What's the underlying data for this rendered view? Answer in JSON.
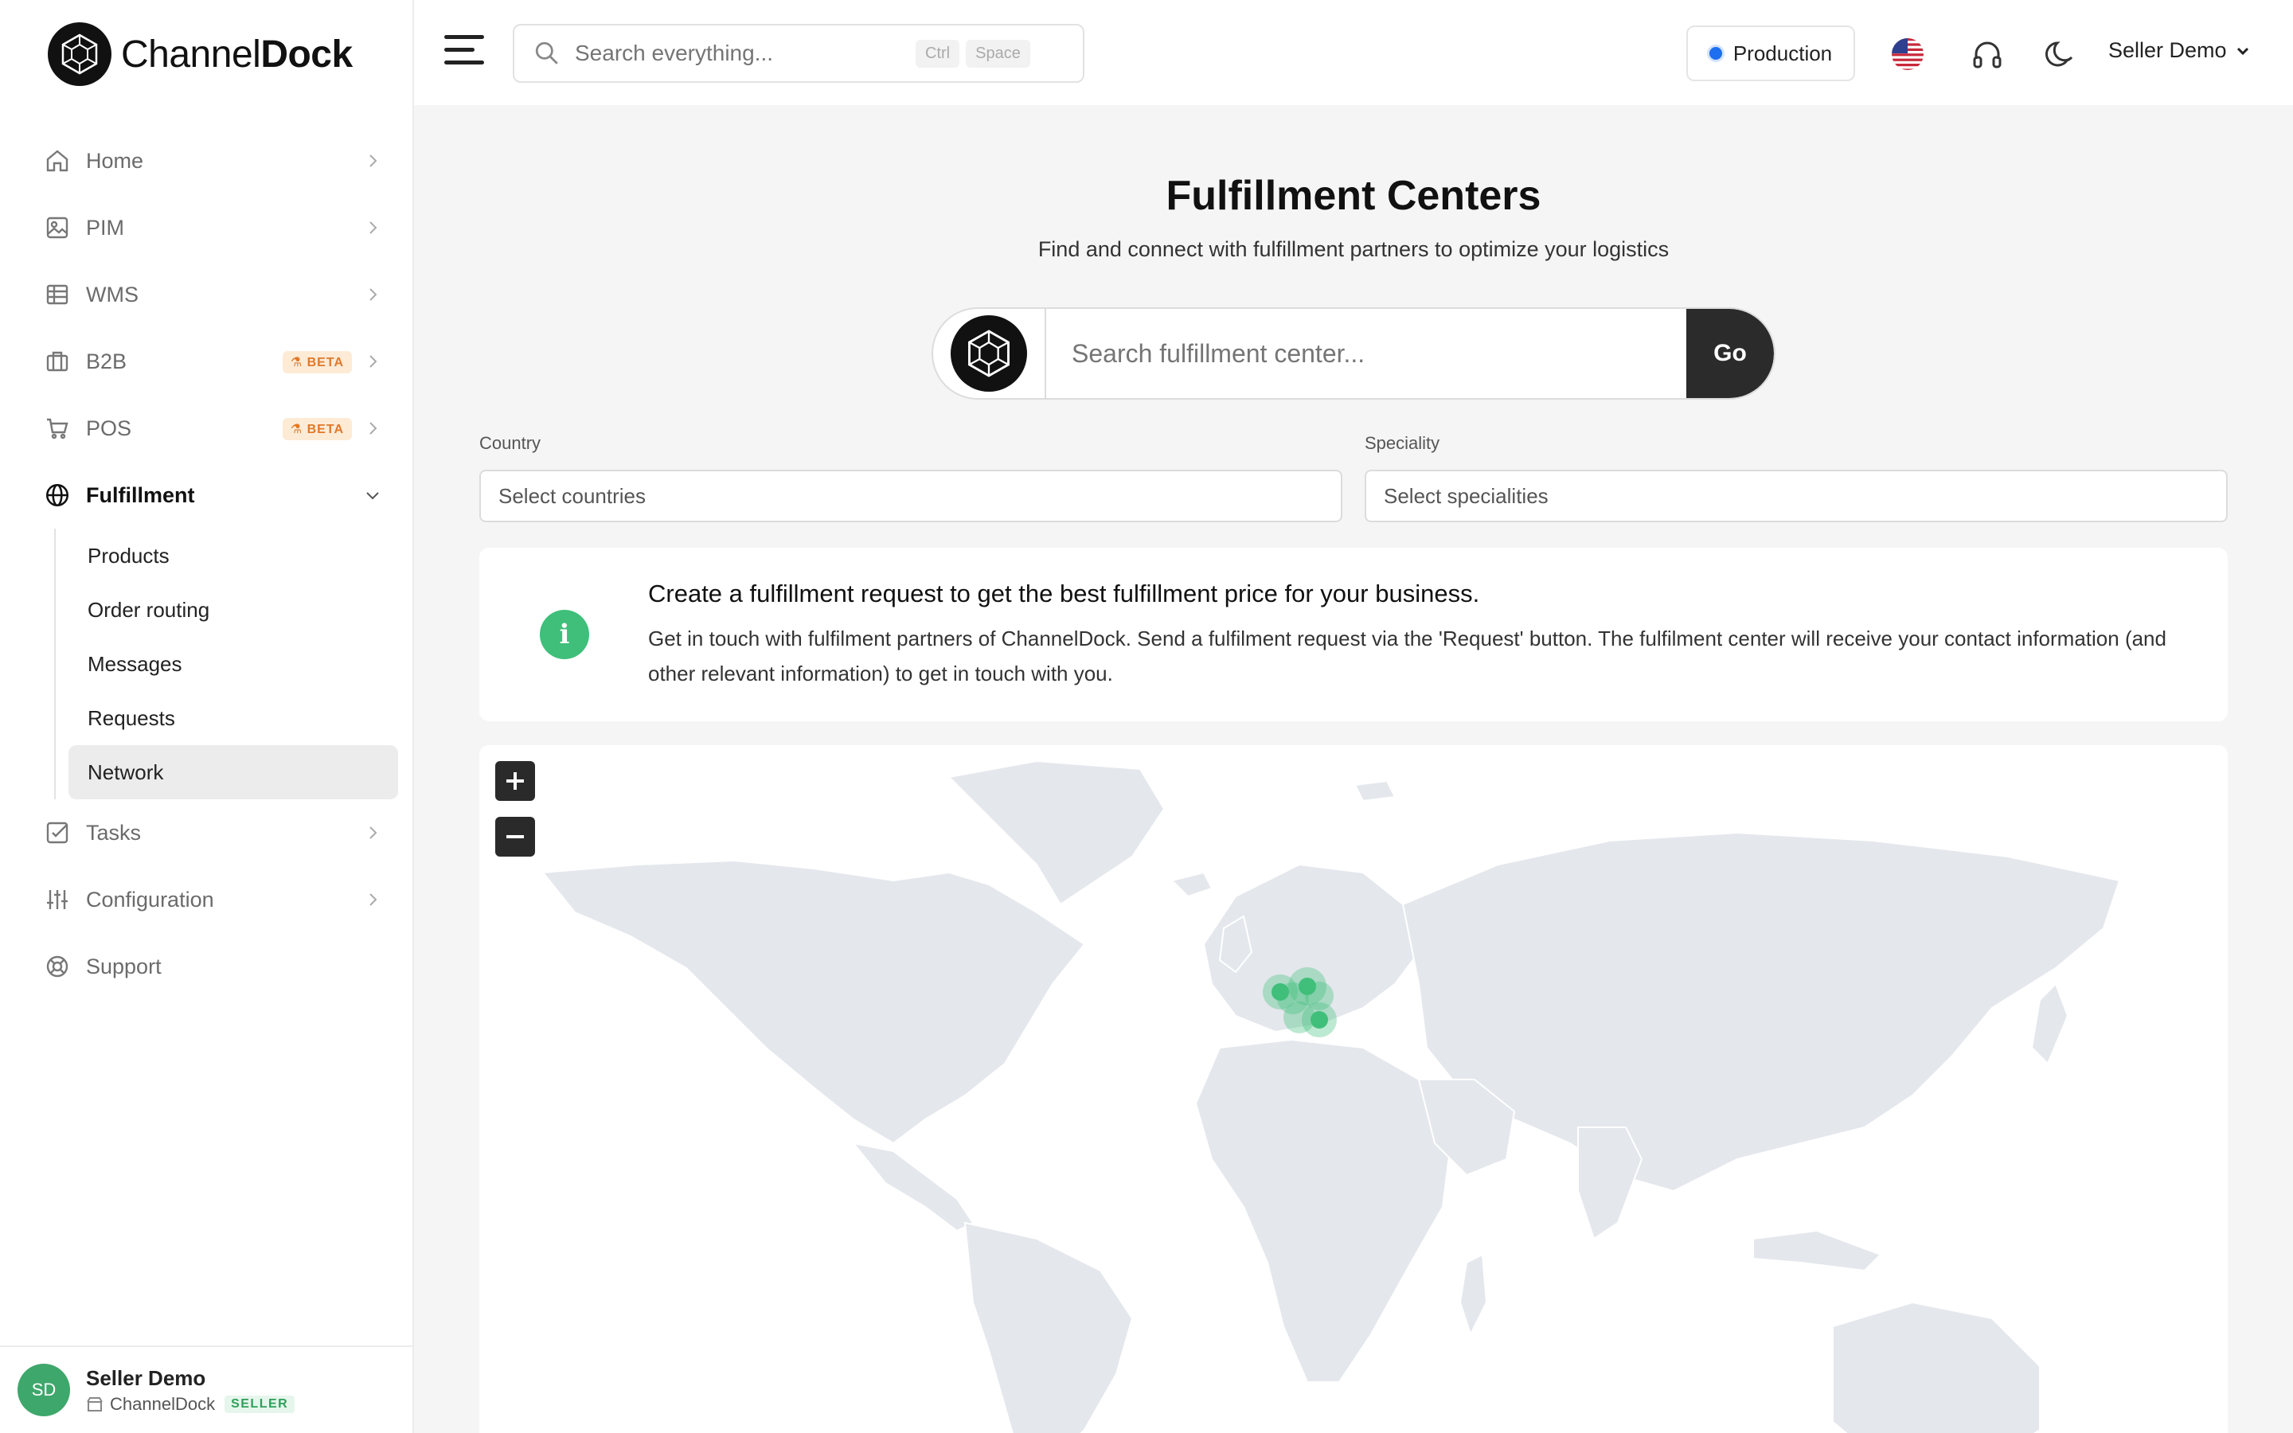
{
  "brand": {
    "name_regular": "Channel",
    "name_bold": "Dock"
  },
  "sidebar": {
    "items": [
      {
        "id": "home",
        "label": "Home",
        "icon": "home-icon"
      },
      {
        "id": "pim",
        "label": "PIM",
        "icon": "image-icon"
      },
      {
        "id": "wms",
        "label": "WMS",
        "icon": "table-icon"
      },
      {
        "id": "b2b",
        "label": "B2B",
        "icon": "briefcase-icon",
        "badge": "BETA"
      },
      {
        "id": "pos",
        "label": "POS",
        "icon": "cart-icon",
        "badge": "BETA"
      },
      {
        "id": "fulfillment",
        "label": "Fulfillment",
        "icon": "globe-icon",
        "expanded": true
      },
      {
        "id": "tasks",
        "label": "Tasks",
        "icon": "checkbox-icon"
      },
      {
        "id": "configuration",
        "label": "Configuration",
        "icon": "sliders-icon"
      },
      {
        "id": "support",
        "label": "Support",
        "icon": "lifebuoy-icon"
      }
    ],
    "fulfillment_sub": [
      "Products",
      "Order routing",
      "Messages",
      "Requests",
      "Network"
    ],
    "selected_sub": "Network"
  },
  "user": {
    "initials": "SD",
    "name": "Seller Demo",
    "org": "ChannelDock",
    "role": "SELLER"
  },
  "header": {
    "search_placeholder": "Search everything...",
    "kbd_1": "Ctrl",
    "kbd_2": "Space",
    "environment": "Production",
    "user_menu": "Seller Demo"
  },
  "main": {
    "title": "Fulfillment Centers",
    "subtitle": "Find and connect with fulfillment partners to optimize your logistics",
    "search_placeholder": "Search fulfillment center...",
    "go_label": "Go",
    "country_label": "Country",
    "country_placeholder": "Select countries",
    "speciality_label": "Speciality",
    "speciality_placeholder": "Select specialities",
    "info_title": "Create a fulfillment request to get the best fulfillment price for your business.",
    "info_text": "Get in touch with fulfilment partners of ChannelDock. Send a fulfilment request via the 'Request' button. The fulfilment center will receive your contact information (and other relevant information) to get in touch with you."
  },
  "colors": {
    "accent": "#3fbf7a",
    "dark": "#2b2b2b",
    "land": "#e4e7ec",
    "env_dot": "#1e6ef0",
    "beta_bg": "#fdebd6",
    "beta_fg": "#e0792b"
  }
}
